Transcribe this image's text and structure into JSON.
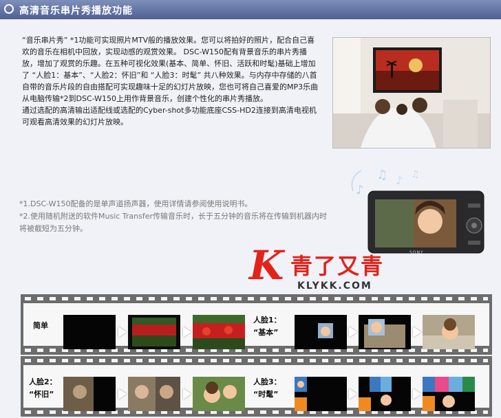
{
  "header": {
    "title": "高清音乐串片秀播放功能"
  },
  "intro": {
    "p1": "“音乐串片秀” *1功能可实现照片MTV般的播放效果。您可以将拍好的照片，配合自己喜欢的音乐在相机中回放，实现动感的观赏效果。 DSC-W150配有背景音乐的串片秀播放，增加了观赏的乐趣。在五种可视化效果(基本、简单、怀旧、活跃和时髦)基础上增加了 “人脸1：基本”、“人脸2：怀旧”和 “人脸3：时髦” 共八种效果。与内存中存储的八首自带的音乐片段的自由搭配可实现趣味十足的幻灯片放映，您也可将自己喜爱的MP3乐曲从电脑传输*2到DSC-W150上用作背景音乐，创建个性化的串片秀播放。",
    "p2": "通过选配的高清输出适配线或选配的Cyber-shot多功能底座CSS-HD2连接到高清电视机可观看高清效果的幻灯片放映。"
  },
  "notes": {
    "n1": "*1.DSC-W150配备的是单声道扬声器，使用详情请参阅使用说明书。",
    "n2": "*2.使用随机附送的软件Music Transfer传输音乐时，长于五分钟的音乐将在传输到机器内时将被截短为五分钟。"
  },
  "camera": {
    "brand": "SONY"
  },
  "watermark": {
    "cn": "青了又青",
    "en": "KLYKK.COM",
    "k": "K"
  },
  "strips": {
    "simple": "简单",
    "face1_a": "人脸1：",
    "face1_b": "“基本”",
    "face2_a": "人脸2：",
    "face2_b": "“怀旧”",
    "face3_a": "人脸3：",
    "face3_b": "“时髦”"
  },
  "colors": {
    "header": "#5a6b9e",
    "strip": "#6c6c6c",
    "logo": "#e2231a"
  }
}
